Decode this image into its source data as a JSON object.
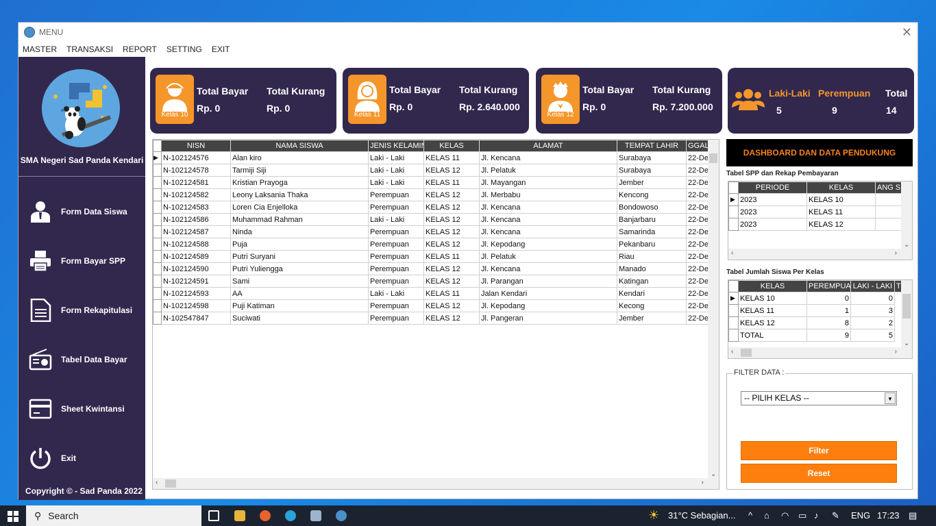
{
  "window": {
    "title": "MENU"
  },
  "menu": [
    "MASTER",
    "TRANSAKSI",
    "REPORT",
    "SETTING",
    "EXIT"
  ],
  "sidebar": {
    "school": "SMA Negeri Sad Panda Kendari",
    "items": [
      {
        "label": "Form Data Siswa",
        "icon": "user-icon"
      },
      {
        "label": "Form Bayar SPP",
        "icon": "printer-icon"
      },
      {
        "label": "Form Rekapitulasi",
        "icon": "document-icon"
      },
      {
        "label": "Tabel Data Bayar",
        "icon": "radio-icon"
      },
      {
        "label": "Sheet Kwintansi",
        "icon": "card-icon"
      },
      {
        "label": "Exit",
        "icon": "power-icon"
      }
    ],
    "copyright": "Copyright © - Sad Panda 2022"
  },
  "cards": [
    {
      "badge": "Kelas 10",
      "bayar_label": "Total Bayar",
      "bayar": "Rp. 0",
      "kurang_label": "Total Kurang",
      "kurang": "Rp. 0"
    },
    {
      "badge": "Kelas 11",
      "bayar_label": "Total Bayar",
      "bayar": "Rp. 0",
      "kurang_label": "Total Kurang",
      "kurang": "Rp. 2.640.000"
    },
    {
      "badge": "Kelas 12",
      "bayar_label": "Total Bayar",
      "bayar": "Rp. 0",
      "kurang_label": "Total Kurang",
      "kurang": "Rp. 7.200.000"
    }
  ],
  "gender": {
    "laki_label": "Laki-Laki",
    "laki": "5",
    "perempuan_label": "Perempuan",
    "perempuan": "9",
    "total_label": "Total",
    "total": "14"
  },
  "grid": {
    "headers": [
      "NISN",
      "NAMA SISWA",
      "JENIS KELAMIN",
      "KELAS",
      "ALAMAT",
      "TEMPAT LAHIR",
      "GGAL L"
    ],
    "rows": [
      [
        "N-102124576",
        "Alan kiro",
        "Laki - Laki",
        "KELAS 11",
        "Jl. Kencana",
        "Surabaya",
        "22-De"
      ],
      [
        "N-102124578",
        "Tarmiji Siji",
        "Laki - Laki",
        "KELAS 12",
        "Jl. Pelatuk",
        "Surabaya",
        "22-De"
      ],
      [
        "N-102124581",
        "Kristian Prayoga",
        "Laki - Laki",
        "KELAS 11",
        "Jl. Mayangan",
        "Jember",
        "22-De"
      ],
      [
        "N-102124582",
        "Leony Laksania Thaka",
        "Perempuan",
        "KELAS 12",
        "Jl. Merbabu",
        "Kencong",
        "22-De"
      ],
      [
        "N-102124583",
        "Loren Cia Enjelloka",
        "Perempuan",
        "KELAS 12",
        "Jl. Kencana",
        "Bondowoso",
        "22-De"
      ],
      [
        "N-102124586",
        "Muhammad Rahman",
        "Laki - Laki",
        "KELAS 12",
        "Jl. Kencana",
        "Banjarbaru",
        "22-De"
      ],
      [
        "N-102124587",
        "Ninda",
        "Perempuan",
        "KELAS 12",
        "Jl. Kencana",
        "Samarinda",
        "22-De"
      ],
      [
        "N-102124588",
        "Puja",
        "Perempuan",
        "KELAS 12",
        "Jl. Kepodang",
        "Pekanbaru",
        "22-De"
      ],
      [
        "N-102124589",
        "Putri Suryani",
        "Perempuan",
        "KELAS 11",
        "Jl. Pelatuk",
        "Riau",
        "22-De"
      ],
      [
        "N-102124590",
        "Putri Yuliengga",
        "Perempuan",
        "KELAS 12",
        "Jl. Kencana",
        "Manado",
        "22-De"
      ],
      [
        "N-102124591",
        "Sami",
        "Perempuan",
        "KELAS 12",
        "Jl. Parangan",
        "Katingan",
        "22-De"
      ],
      [
        "N-102124593",
        "AA",
        "Laki - Laki",
        "KELAS 11",
        "Jalan Kendari",
        "Kendari",
        "22-De"
      ],
      [
        "N-102124598",
        "Puji Katiman",
        "Perempuan",
        "KELAS 12",
        "Jl. Kepodang",
        "Kecong",
        "22-De"
      ],
      [
        "N-102547847",
        "Suciwati",
        "Perempuan",
        "KELAS 12",
        "Jl. Pangeran",
        "Jember",
        "22-De"
      ]
    ]
  },
  "dashboard": {
    "title": "DASHBOARD DAN DATA PENDUKUNG",
    "spp_label": "Tabel SPP dan Rekap Pembayaran",
    "spp_headers": [
      "PERIODE",
      "KELAS",
      "ANG SP"
    ],
    "spp_rows": [
      [
        "2023",
        "KELAS 10",
        ""
      ],
      [
        "2023",
        "KELAS 11",
        ""
      ],
      [
        "2023",
        "KELAS 12",
        ""
      ]
    ],
    "siswa_label": "Tabel Jumlah Siswa Per Kelas",
    "siswa_headers": [
      "KELAS",
      "PEREMPUAN",
      "LAKI - LAKI",
      "T"
    ],
    "siswa_rows": [
      [
        "KELAS 10",
        "0",
        "0"
      ],
      [
        "KELAS 11",
        "1",
        "3"
      ],
      [
        "KELAS 12",
        "8",
        "2"
      ],
      [
        "TOTAL",
        "9",
        "5"
      ]
    ]
  },
  "filter": {
    "legend": "FILTER DATA :",
    "select_value": "-- PILIH KELAS --",
    "filter_label": "Filter",
    "reset_label": "Reset"
  },
  "taskbar": {
    "search": "Search",
    "weather": "31°C  Sebagian...",
    "lang": "ENG",
    "time": "17:23"
  }
}
